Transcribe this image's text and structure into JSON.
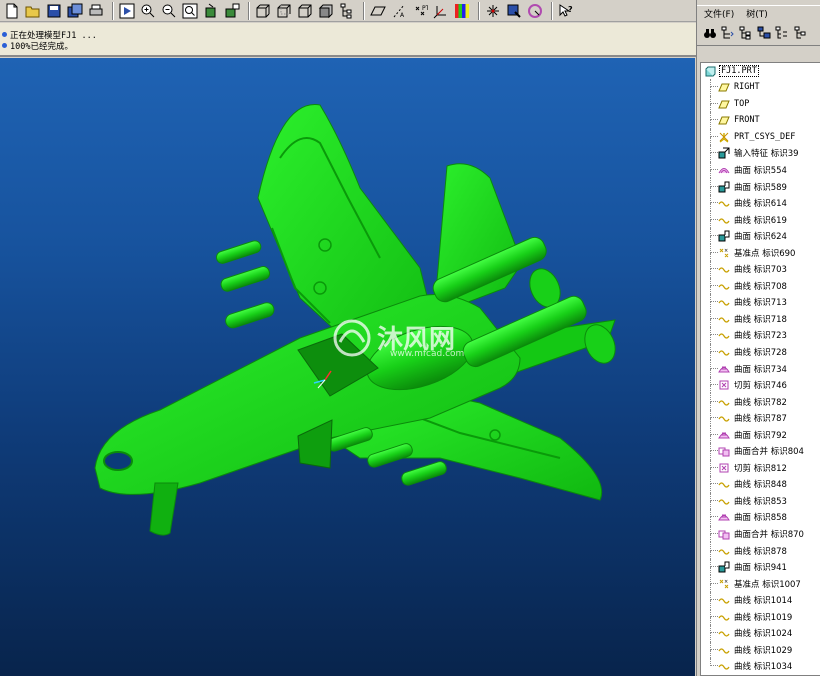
{
  "messages": [
    "正在处理模型FJ1 ...",
    "100%已经完成。"
  ],
  "menu": {
    "file": "文件(F)",
    "tree": "树(T)"
  },
  "tree": {
    "root": "FJ1.PRT",
    "items": [
      {
        "label": "RIGHT",
        "icon": "datum-plane-icon"
      },
      {
        "label": "TOP",
        "icon": "datum-plane-icon"
      },
      {
        "label": "FRONT",
        "icon": "datum-plane-icon"
      },
      {
        "label": "PRT_CSYS_DEF",
        "icon": "coordinate-system-icon"
      },
      {
        "label": "输入特征 标识39",
        "icon": "import-feature-icon"
      },
      {
        "label": "曲面 标识554",
        "icon": "surface-icon"
      },
      {
        "label": "曲面 标识589",
        "icon": "surface-extrude-icon"
      },
      {
        "label": "曲线 标识614",
        "icon": "curve-icon"
      },
      {
        "label": "曲线 标识619",
        "icon": "curve-icon"
      },
      {
        "label": "曲面 标识624",
        "icon": "surface-extrude-icon"
      },
      {
        "label": "基准点 标识690",
        "icon": "datum-point-icon"
      },
      {
        "label": "曲线 标识703",
        "icon": "curve-icon"
      },
      {
        "label": "曲线 标识708",
        "icon": "curve-icon"
      },
      {
        "label": "曲线 标识713",
        "icon": "curve-icon"
      },
      {
        "label": "曲线 标识718",
        "icon": "curve-icon"
      },
      {
        "label": "曲线 标识723",
        "icon": "curve-icon"
      },
      {
        "label": "曲线 标识728",
        "icon": "curve-icon"
      },
      {
        "label": "曲面 标识734",
        "icon": "boundary-surface-icon"
      },
      {
        "label": "切剪 标识746",
        "icon": "trim-icon"
      },
      {
        "label": "曲线 标识782",
        "icon": "curve-icon"
      },
      {
        "label": "曲线 标识787",
        "icon": "curve-icon"
      },
      {
        "label": "曲面 标识792",
        "icon": "boundary-surface-icon"
      },
      {
        "label": "曲面合并 标识804",
        "icon": "merge-icon"
      },
      {
        "label": "切剪 标识812",
        "icon": "trim-icon"
      },
      {
        "label": "曲线 标识848",
        "icon": "curve-icon"
      },
      {
        "label": "曲线 标识853",
        "icon": "curve-icon"
      },
      {
        "label": "曲面 标识858",
        "icon": "boundary-surface-icon"
      },
      {
        "label": "曲面合并 标识870",
        "icon": "merge-icon"
      },
      {
        "label": "曲线 标识878",
        "icon": "curve-icon"
      },
      {
        "label": "曲面 标识941",
        "icon": "surface-extrude-icon"
      },
      {
        "label": "基准点 标识1007",
        "icon": "datum-point-icon"
      },
      {
        "label": "曲线 标识1014",
        "icon": "curve-icon"
      },
      {
        "label": "曲线 标识1019",
        "icon": "curve-icon"
      },
      {
        "label": "曲线 标识1024",
        "icon": "curve-icon"
      },
      {
        "label": "曲线 标识1029",
        "icon": "curve-icon"
      },
      {
        "label": "曲线 标识1034",
        "icon": "curve-icon"
      }
    ]
  },
  "watermark": {
    "brand": "沐风网",
    "url": "www.mfcad.com"
  },
  "colors": {
    "model": "#1ee61e",
    "model_shade": "#0fa80f",
    "viewport_top": "#1f63b4",
    "viewport_bottom": "#08244c"
  }
}
